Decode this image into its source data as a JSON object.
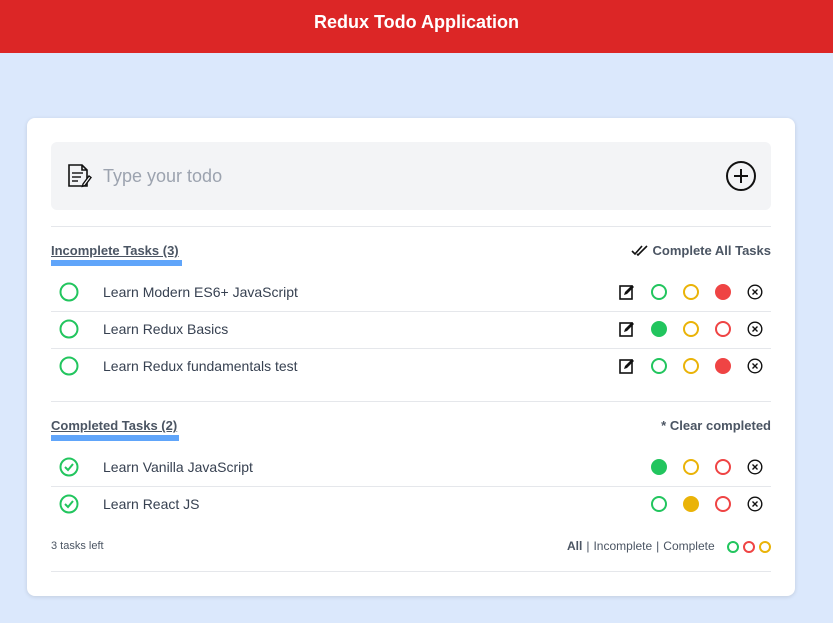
{
  "header": {
    "title": "Redux Todo Application"
  },
  "input": {
    "placeholder": "Type your todo",
    "value": ""
  },
  "incomplete": {
    "title": "Incomplete Tasks (3)",
    "action_label": "Complete All Tasks",
    "tasks": [
      {
        "text": "Learn Modern ES6+ JavaScript",
        "color": "red"
      },
      {
        "text": "Learn Redux Basics",
        "color": "green"
      },
      {
        "text": "Learn Redux fundamentals test",
        "color": "red"
      }
    ]
  },
  "completed": {
    "title": "Completed Tasks (2)",
    "action_label": "* Clear completed",
    "tasks": [
      {
        "text": "Learn Vanilla JavaScript",
        "color": "green"
      },
      {
        "text": "Learn React JS",
        "color": "yellow"
      }
    ]
  },
  "footer": {
    "tasks_left": "3 tasks left",
    "filter_all": "All",
    "separator": "|",
    "filter_incomplete": "Incomplete",
    "filter_complete": "Complete"
  },
  "colors": {
    "header": "#dc2626",
    "green": "#22c55e",
    "yellow": "#eab308",
    "red": "#ef4444",
    "accent_bar": "#60a5fa"
  }
}
